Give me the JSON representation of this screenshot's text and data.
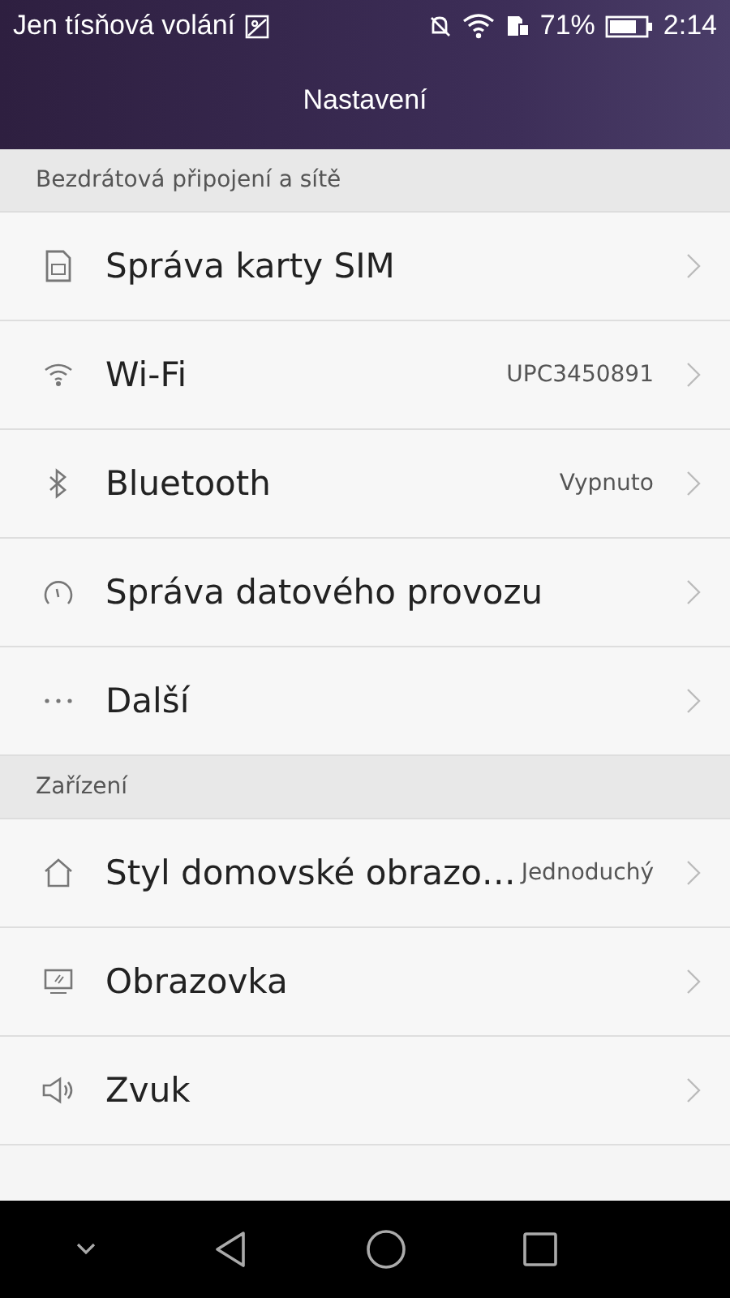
{
  "status_bar": {
    "carrier": "Jen tísňová volání",
    "battery": "71%",
    "time": "2:14"
  },
  "title": "Nastavení",
  "sections": [
    {
      "header": "Bezdrátová připojení a sítě",
      "items": [
        {
          "kind": "sim",
          "label": "Správa karty SIM"
        },
        {
          "kind": "wifi",
          "label": "Wi-Fi",
          "value": "UPC3450891"
        },
        {
          "kind": "bluetooth",
          "label": "Bluetooth",
          "value": "Vypnuto"
        },
        {
          "kind": "data",
          "label": "Správa datového provozu"
        },
        {
          "kind": "more",
          "label": "Další"
        }
      ]
    },
    {
      "header": "Zařízení",
      "items": [
        {
          "kind": "home",
          "label": "Styl domovské obrazo…",
          "value": "Jednoduchý"
        },
        {
          "kind": "display",
          "label": "Obrazovka"
        },
        {
          "kind": "sound",
          "label": "Zvuk"
        }
      ]
    }
  ]
}
